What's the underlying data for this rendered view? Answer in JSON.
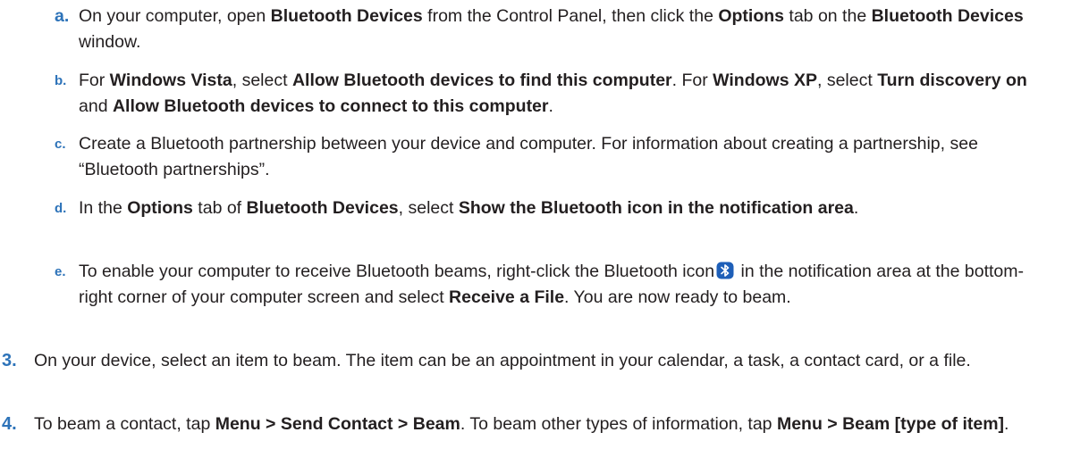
{
  "colors": {
    "marker": "#2d73b9",
    "text": "#231f20",
    "bluetooth_icon": "#1e5fb8"
  },
  "steps": [
    {
      "marker": "a.",
      "segments": [
        "On your computer, open ",
        "Bluetooth Devices",
        " from the Control Panel, then click the ",
        "Options",
        " tab on the ",
        "Bluetooth Devices",
        " window."
      ]
    },
    {
      "marker": "b.",
      "segments": [
        "For ",
        "Windows Vista",
        ", select ",
        "Allow Bluetooth devices to find this computer",
        ". For ",
        "Windows XP",
        ", select ",
        "Turn discovery on",
        " and ",
        "Allow Bluetooth devices to connect to this computer",
        "."
      ]
    },
    {
      "marker": "c.",
      "segments": [
        "Create a Bluetooth partnership between your device and computer. For information about creating a partnership, see “Bluetooth partnerships”."
      ]
    },
    {
      "marker": "d.",
      "segments": [
        "In the ",
        "Options",
        " tab of ",
        "Bluetooth Devices",
        ", select ",
        "Show the Bluetooth icon in the notification area",
        "."
      ]
    },
    {
      "marker": "e.",
      "segments": [
        "To enable your computer to receive Bluetooth beams, right-click the Bluetooth icon",
        " in the notification area at the bottom-right corner of your computer screen and select ",
        "Receive a File",
        ". You are now ready to beam."
      ],
      "icon": "bluetooth-icon"
    },
    {
      "marker": "3.",
      "segments": [
        "On your device, select an item to beam. The item can be an appointment in your calendar, a task, a contact card, or a file."
      ]
    },
    {
      "marker": "4.",
      "segments": [
        "To beam a contact, tap ",
        "Menu > Send Contact > Beam",
        ". To beam other types of information, tap ",
        "Menu > Beam [type of item]",
        "."
      ]
    }
  ]
}
